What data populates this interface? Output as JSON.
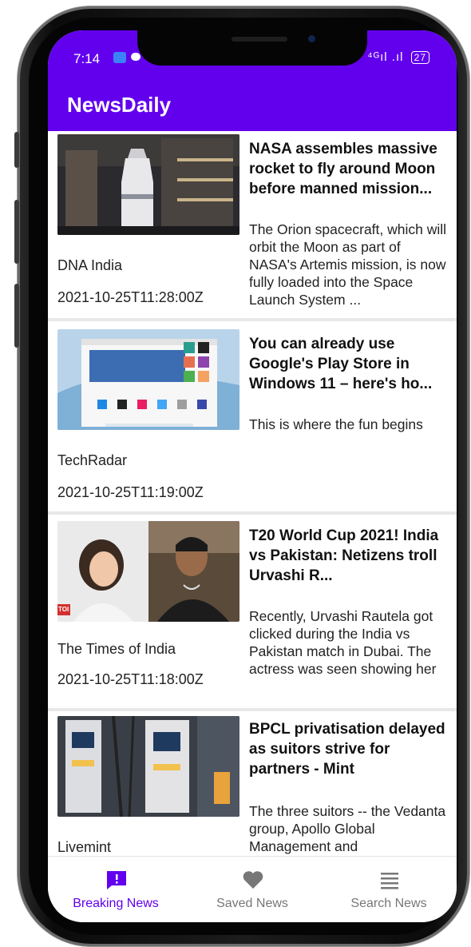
{
  "status": {
    "time": "7:14",
    "signal": "⁴ᴳıl .ıl",
    "battery": "27"
  },
  "app": {
    "title": "NewsDaily"
  },
  "articles": [
    {
      "headline": "NASA assembles massive rocket to fly around Moon before manned mission...",
      "description": "The Orion spacecraft, which will orbit the Moon as part of NASA's Artemis mission, is now fully loaded into the Space Launch System ...",
      "source": "DNA India",
      "date": "2021-10-25T11:28:00Z"
    },
    {
      "headline": "You can already use Google's Play Store in Windows 11 – here's ho...",
      "description": "This is where the fun begins",
      "source": "TechRadar",
      "date": "2021-10-25T11:19:00Z"
    },
    {
      "headline": "T20 World Cup 2021! India vs Pakistan: Netizens troll Urvashi R...",
      "description": "Recently, Urvashi Rautela got clicked during the India vs Pakistan match in Dubai. The actress was seen showing her",
      "source": "The Times of India",
      "date": "2021-10-25T11:18:00Z"
    },
    {
      "headline": "BPCL privatisation delayed as suitors strive for partners - Mint",
      "description": "The three suitors -- the Vedanta group, Apollo Global Management and",
      "source": "Livemint",
      "date": ""
    }
  ],
  "thumb_badge": "TOI",
  "nav": [
    {
      "label": "Breaking News",
      "icon": "breaking-news-icon",
      "active": true
    },
    {
      "label": "Saved News",
      "icon": "heart-icon",
      "active": false
    },
    {
      "label": "Search News",
      "icon": "menu-lines-icon",
      "active": false
    }
  ],
  "colors": {
    "primary": "#6200ee",
    "inactive": "#777777"
  }
}
